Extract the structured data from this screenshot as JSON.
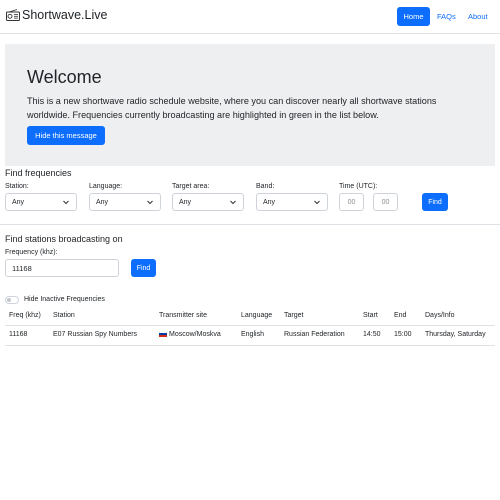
{
  "nav": {
    "brand": "Shortwave.Live",
    "home": "Home",
    "faqs": "FAQs",
    "about": "About"
  },
  "welcome": {
    "title": "Welcome",
    "text": "This is a new shortwave radio schedule website, where you can discover nearly all shortwave stations worldwide. Frequencies currently broadcasting are highlighted in green in the list below.",
    "hide_button": "Hide this message"
  },
  "find_frequencies": {
    "title": "Find frequencies",
    "station_label": "Station:",
    "station_value": "Any",
    "language_label": "Language:",
    "language_value": "Any",
    "target_label": "Target area:",
    "target_value": "Any",
    "band_label": "Band:",
    "band_value": "Any",
    "time_label": "Time (UTC):",
    "time_from_placeholder": "00",
    "time_to_placeholder": "00",
    "find_button": "Find"
  },
  "find_stations": {
    "title": "Find stations broadcasting on",
    "freq_label": "Frequency (khz):",
    "freq_value": "11168",
    "find_button": "Find"
  },
  "filter": {
    "hide_inactive_label": "Hide Inactive Frequencies",
    "hide_inactive_on": false
  },
  "table": {
    "headers": [
      "Freq (khz)",
      "Station",
      "Transmitter site",
      "Language",
      "Target",
      "Start",
      "End",
      "Days/Info"
    ],
    "rows": [
      {
        "freq": "11168",
        "station": "E07 Russian Spy Numbers",
        "site": "Moscow/Moskva",
        "language": "English",
        "target": "Russian Federation",
        "start": "14:50",
        "end": "15:00",
        "days": "Thursday, Saturday"
      }
    ]
  },
  "colors": {
    "primary": "#0d6efd",
    "jumbotron_bg": "#eeeff1"
  }
}
